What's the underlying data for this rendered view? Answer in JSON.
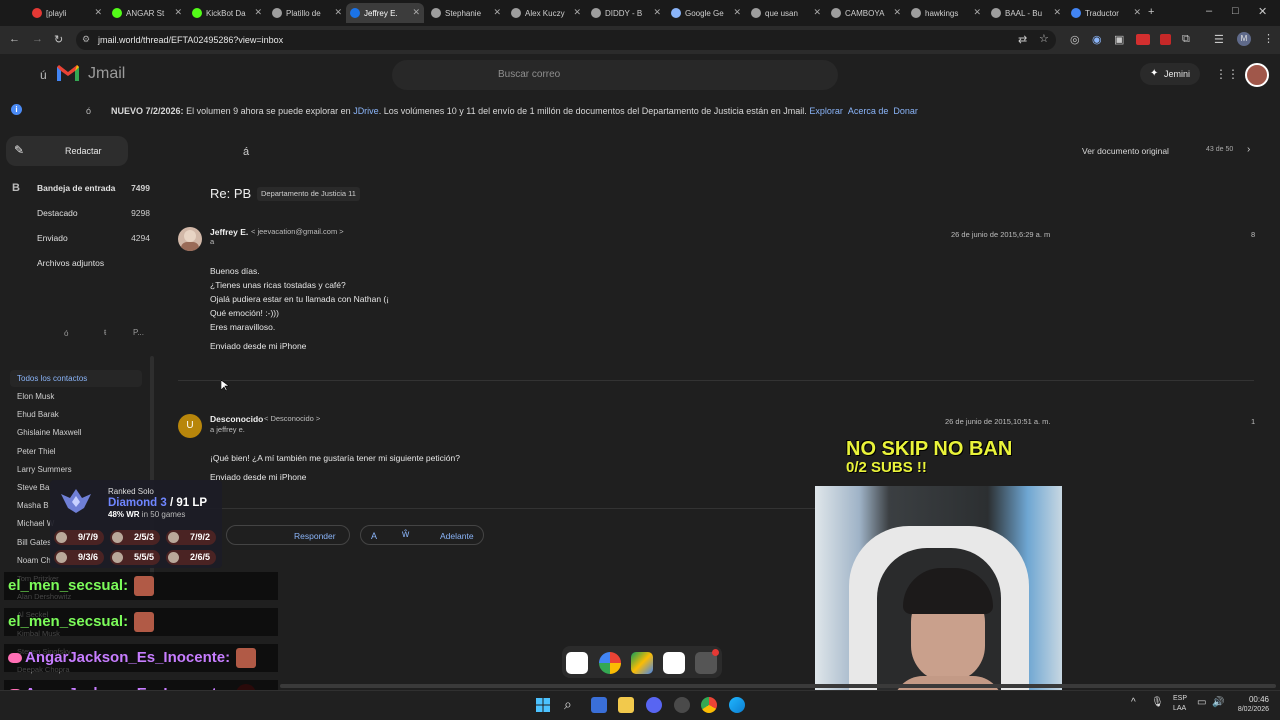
{
  "browser": {
    "tabs": [
      {
        "label": "[playli",
        "color": "#e53935"
      },
      {
        "label": "ANGAR St",
        "color": "#53fc18"
      },
      {
        "label": "KickBot Da",
        "color": "#53fc18"
      },
      {
        "label": "Platillo de",
        "color": "#9e9e9e"
      },
      {
        "label": "Jeffrey E.",
        "color": "#1a73e8"
      },
      {
        "label": "Stephanie",
        "color": "#9e9e9e"
      },
      {
        "label": "Alex Kuczy",
        "color": "#9e9e9e"
      },
      {
        "label": "DIDDY - B",
        "color": "#9e9e9e"
      },
      {
        "label": "Google Ge",
        "color": "#8ab4f8"
      },
      {
        "label": "que usan",
        "color": "#9e9e9e"
      },
      {
        "label": "CAMBOYA",
        "color": "#9e9e9e"
      },
      {
        "label": "hawkings",
        "color": "#9e9e9e"
      },
      {
        "label": "BAAL - Bu",
        "color": "#9e9e9e"
      },
      {
        "label": "Traductor",
        "color": "#4285f4"
      }
    ],
    "url": "jmail.world/thread/EFTA02495286?view=inbox"
  },
  "app": {
    "logo_prefix": "ú",
    "logo_text": "Jmail",
    "search_placeholder": "Buscar correo",
    "jemini_label": "Jemini",
    "notice": {
      "info_glyph": "ó",
      "lead": "NUEVO 7/2/2026:",
      "text": "El volumen 9 ahora se puede explorar en",
      "jdrive": "JDrive",
      "text2": ". Los volúmenes 10 y 11 del envío de 1 millón de documentos del Departamento de Justicia están en Jmail.",
      "explore": "Explorar",
      "about": "Acerca de",
      "donate": "Donar"
    },
    "compose_label": "Redactar",
    "nav": [
      {
        "icon": "B",
        "label": "Bandeja de entrada",
        "count": "7499"
      },
      {
        "icon": "",
        "label": "Destacado",
        "count": "9298"
      },
      {
        "icon": "",
        "label": "Enviado",
        "count": "4294"
      },
      {
        "icon": "",
        "label": "Archivos adjuntos",
        "count": ""
      }
    ],
    "sidebar_glyphs": [
      "ó",
      "ŧ",
      "P..."
    ],
    "contacts_header": "Todos los contactos",
    "contacts": [
      "Elon Musk",
      "Ehud Barak",
      "Ghislaine Maxwell",
      "Peter Thiel",
      "Larry Summers",
      "Steve Ba",
      "Masha B",
      "Michael W",
      "Bill Gates",
      "Noam Ch",
      "Tom Pritzker",
      "Alan Dershowitz",
      "Al Seckel",
      "Kimbal Musk",
      "Steven Sinofsky",
      "Deepak Chopra"
    ]
  },
  "thread": {
    "back_glyph": "á",
    "view_original": "Ver documento original",
    "position": "43 de 50",
    "subject": "Re: PB",
    "tag": "Departamento de Justicia 11",
    "messages": [
      {
        "sender": "Jeffrey E.",
        "email": "< jeevacation@gmail.com >",
        "to": "a",
        "date": "26 de junio de 2015,6:29 a. m",
        "index": "8",
        "lines": [
          "Buenos días.",
          "¿Tienes unas ricas tostadas y café?",
          "Ojalá pudiera estar en tu llamada con Nathan (¡",
          "Qué emoción! :-)))",
          "Eres maravilloso.",
          "",
          "Enviado desde mi iPhone"
        ]
      },
      {
        "sender": "Desconocido",
        "email": "< Desconocido >",
        "to": "a jeffrey e.",
        "avatar": "U",
        "date": "26 de junio de 2015,10:51 a. m.",
        "index": "1",
        "lines": [
          "¡Qué bien! ¿A mí también me gustaría tener mi siguiente petición?",
          "Enviado desde mi iPhone"
        ]
      }
    ],
    "reply_label": "Responder",
    "forward_label": "Adelante",
    "action_glyph_a": "A",
    "action_glyph_b": "ŵ"
  },
  "overlay": {
    "rank_title": "Ranked Solo",
    "rank_tier": "Diamond 3",
    "rank_lp": "91 LP",
    "rank_winrate": "48% WR",
    "rank_games": "in 50 games",
    "kda": [
      "9/7/9",
      "2/5/3",
      "7/9/2",
      "9/3/6",
      "5/5/5",
      "2/6/5"
    ],
    "chat": [
      {
        "user": "el_men_secsual:",
        "color": "#7cfc5a"
      },
      {
        "user": "el_men_secsual:",
        "color": "#7cfc5a"
      },
      {
        "user": "AngarJackson_Es_Inocente:",
        "color": "#c77dff"
      },
      {
        "user": "AngarJackson_Es_Inocente:",
        "color": "#c77dff"
      }
    ],
    "noskip": "NO SKIP NO BAN",
    "subs": "0/2 SUBS !!"
  },
  "taskbar": {
    "lang": "ESP",
    "region": "LAA",
    "time": "00:46",
    "date": "8/02/2026"
  }
}
